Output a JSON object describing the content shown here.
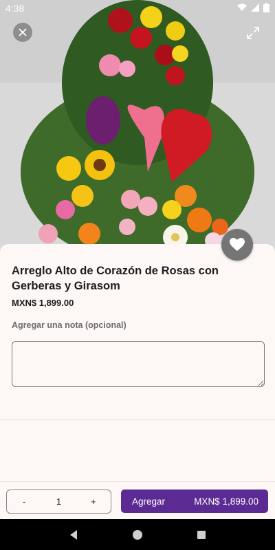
{
  "status_bar": {
    "time": "4:38"
  },
  "product": {
    "title": "Arreglo Alto de Corazón de Rosas con Gerberas y Girasom",
    "price": "MXN$ 1,899.00"
  },
  "note": {
    "label": "Agregar una nota (opcional)",
    "placeholder": ""
  },
  "quantity": {
    "minus": "-",
    "value": "1",
    "plus": "+"
  },
  "add_button": {
    "label": "Agregar",
    "price": "MXN$ 1,899.00"
  },
  "colors": {
    "accent": "#5b2b93",
    "fav_bg": "#757575"
  },
  "icons": [
    "close-icon",
    "expand-icon",
    "heart-icon",
    "back-nav-icon",
    "home-nav-icon",
    "recents-nav-icon",
    "wifi-icon",
    "signal-icon",
    "battery-icon"
  ]
}
